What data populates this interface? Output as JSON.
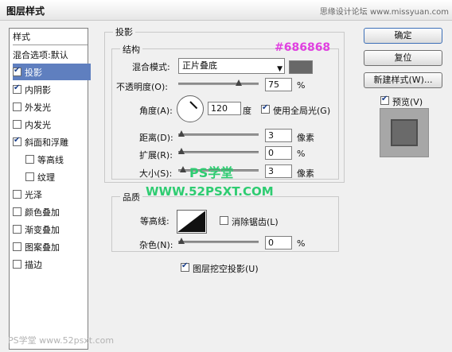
{
  "window": {
    "title": "图层样式",
    "watermark": "思缘设计论坛 www.missyuan.com"
  },
  "left_panel": {
    "header": "样式",
    "blend_default": "混合选项:默认",
    "items": [
      {
        "label": "投影",
        "checked": true,
        "selected": true,
        "indent": false
      },
      {
        "label": "内阴影",
        "checked": true,
        "selected": false,
        "indent": false
      },
      {
        "label": "外发光",
        "checked": false,
        "selected": false,
        "indent": false
      },
      {
        "label": "内发光",
        "checked": false,
        "selected": false,
        "indent": false
      },
      {
        "label": "斜面和浮雕",
        "checked": true,
        "selected": false,
        "indent": false
      },
      {
        "label": "等高线",
        "checked": false,
        "selected": false,
        "indent": true
      },
      {
        "label": "纹理",
        "checked": false,
        "selected": false,
        "indent": true
      },
      {
        "label": "光泽",
        "checked": false,
        "selected": false,
        "indent": false
      },
      {
        "label": "颜色叠加",
        "checked": false,
        "selected": false,
        "indent": false
      },
      {
        "label": "渐变叠加",
        "checked": false,
        "selected": false,
        "indent": false
      },
      {
        "label": "图案叠加",
        "checked": false,
        "selected": false,
        "indent": false
      },
      {
        "label": "描边",
        "checked": false,
        "selected": false,
        "indent": false
      }
    ]
  },
  "shadow": {
    "group_title": "投影",
    "struct_title": "结构",
    "blend_mode_label": "混合模式:",
    "blend_mode_value": "正片叠底",
    "color_hex": "#686868",
    "opacity_label": "不透明度(O):",
    "opacity_value": "75",
    "opacity_unit": "%",
    "angle_label": "角度(A):",
    "angle_value": "120",
    "angle_unit": "度",
    "global_light_label": "使用全局光(G)",
    "distance_label": "距离(D):",
    "distance_value": "3",
    "distance_unit": "像素",
    "spread_label": "扩展(R):",
    "spread_value": "0",
    "spread_unit": "%",
    "size_label": "大小(S):",
    "size_value": "3",
    "size_unit": "像素"
  },
  "quality": {
    "title": "品质",
    "contour_label": "等高线:",
    "antialias_label": "消除锯齿(L)",
    "noise_label": "杂色(N):",
    "noise_value": "0",
    "noise_unit": "%",
    "knockout_label": "图层挖空投影(U)"
  },
  "buttons": {
    "ok": "确定",
    "reset": "复位",
    "new_style": "新建样式(W)...",
    "preview_label": "预览(V)"
  },
  "overlays": {
    "stamp1": "PS学堂",
    "stamp2": "WWW.52PSXT.COM",
    "foot": "PS学堂 www.52psxt.com"
  }
}
